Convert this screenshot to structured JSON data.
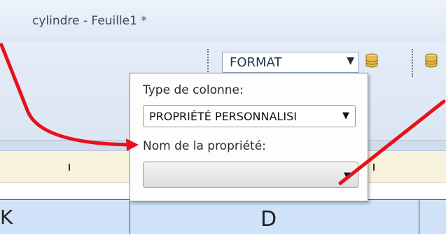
{
  "window": {
    "title": "cylindre - Feuille1 *"
  },
  "toolbar": {
    "format_combo_value": "FORMAT",
    "format_combo_icon": "chevron-down-icon",
    "db_icon": "database-icon"
  },
  "popup": {
    "column_type_label": "Type de colonne:",
    "column_type_value": "PROPRIÉTÉ PERSONNALISI",
    "property_name_label": "Nom de la propriété:",
    "property_name_value": ""
  },
  "grid": {
    "column_d_label": "D",
    "column_c_partial": "K"
  },
  "colors": {
    "annotation": "#e8101a",
    "column_header_bg": "#cfe2f8",
    "ruler_bg": "#f7f2dc"
  }
}
